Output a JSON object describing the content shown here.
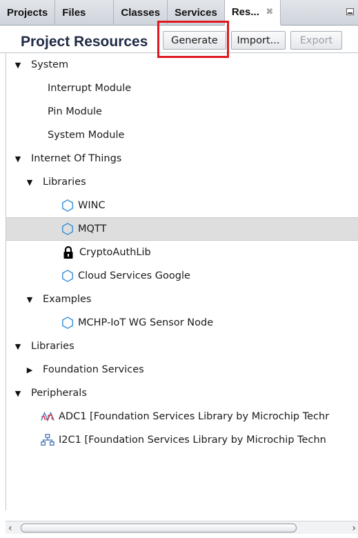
{
  "tabs": [
    {
      "label": "Projects",
      "active": false
    },
    {
      "label": "Files",
      "active": false
    },
    {
      "label": "Classes",
      "active": false
    },
    {
      "label": "Services",
      "active": false
    },
    {
      "label": "Res...",
      "active": true
    }
  ],
  "tab_close_glyph": "⌘",
  "panel": {
    "title": "Project Resources",
    "buttons": {
      "generate": "Generate",
      "import": "Import...",
      "export": "Export"
    }
  },
  "tree": {
    "system": "System",
    "interrupt_module": "Interrupt Module",
    "pin_module": "Pin Module",
    "system_module": "System Module",
    "iot": "Internet Of Things",
    "iot_libraries": "Libraries",
    "winc": "WINC",
    "mqtt": "MQTT",
    "cryptoauthlib": "CryptoAuthLib",
    "cloud_services_google": "Cloud Services Google",
    "examples": "Examples",
    "sensor_node": "MCHP-IoT WG Sensor Node",
    "libraries": "Libraries",
    "foundation_services": "Foundation Services",
    "peripherals": "Peripherals",
    "adc1": "ADC1 [Foundation Services Library by Microchip Techr",
    "i2c1": "I2C1 [Foundation Services Library by Microchip Techn"
  },
  "selected_item": "MQTT",
  "colors": {
    "accent_highlight": "#e0171e",
    "hex_icon": "#3a8fd6",
    "selected_row": "#dedede"
  }
}
